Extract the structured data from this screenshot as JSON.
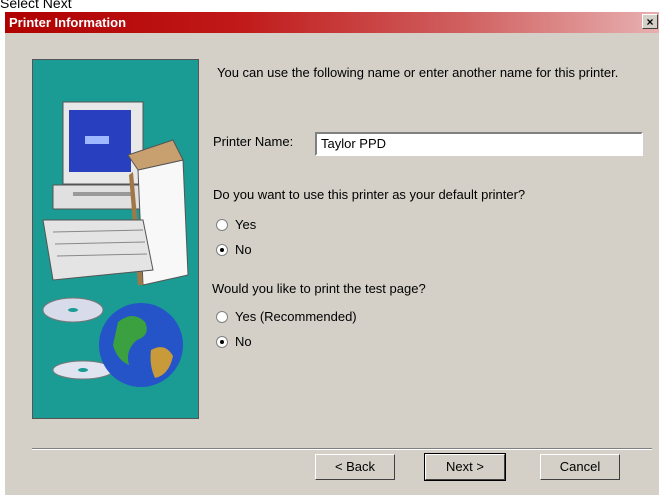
{
  "caption": "Select Next",
  "dialog": {
    "title": "Printer Information",
    "close_glyph": "×",
    "intro_text": "You can use the following name or enter another name for this printer.",
    "printer_name_label": "Printer Name:",
    "printer_name_value": "Taylor PPD",
    "default_question": "Do you want to use this printer as your default printer?",
    "default_options": [
      {
        "label": "Yes",
        "checked": false
      },
      {
        "label": "No",
        "checked": true
      }
    ],
    "test_page_question": "Would you like to print the test page?",
    "test_page_options": [
      {
        "label": "Yes (Recommended)",
        "checked": false
      },
      {
        "label": "No",
        "checked": true
      }
    ],
    "buttons": {
      "back": "< Back",
      "next": "Next >",
      "cancel": "Cancel"
    }
  },
  "icons": {
    "wizard_art": "computer-printer-globe-illustration",
    "close": "close-icon"
  },
  "colors": {
    "titlebar_start": "#b00000",
    "titlebar_end": "#e8b0b0",
    "panel_background": "#1a9c94",
    "window_background": "#d4d0c8"
  }
}
